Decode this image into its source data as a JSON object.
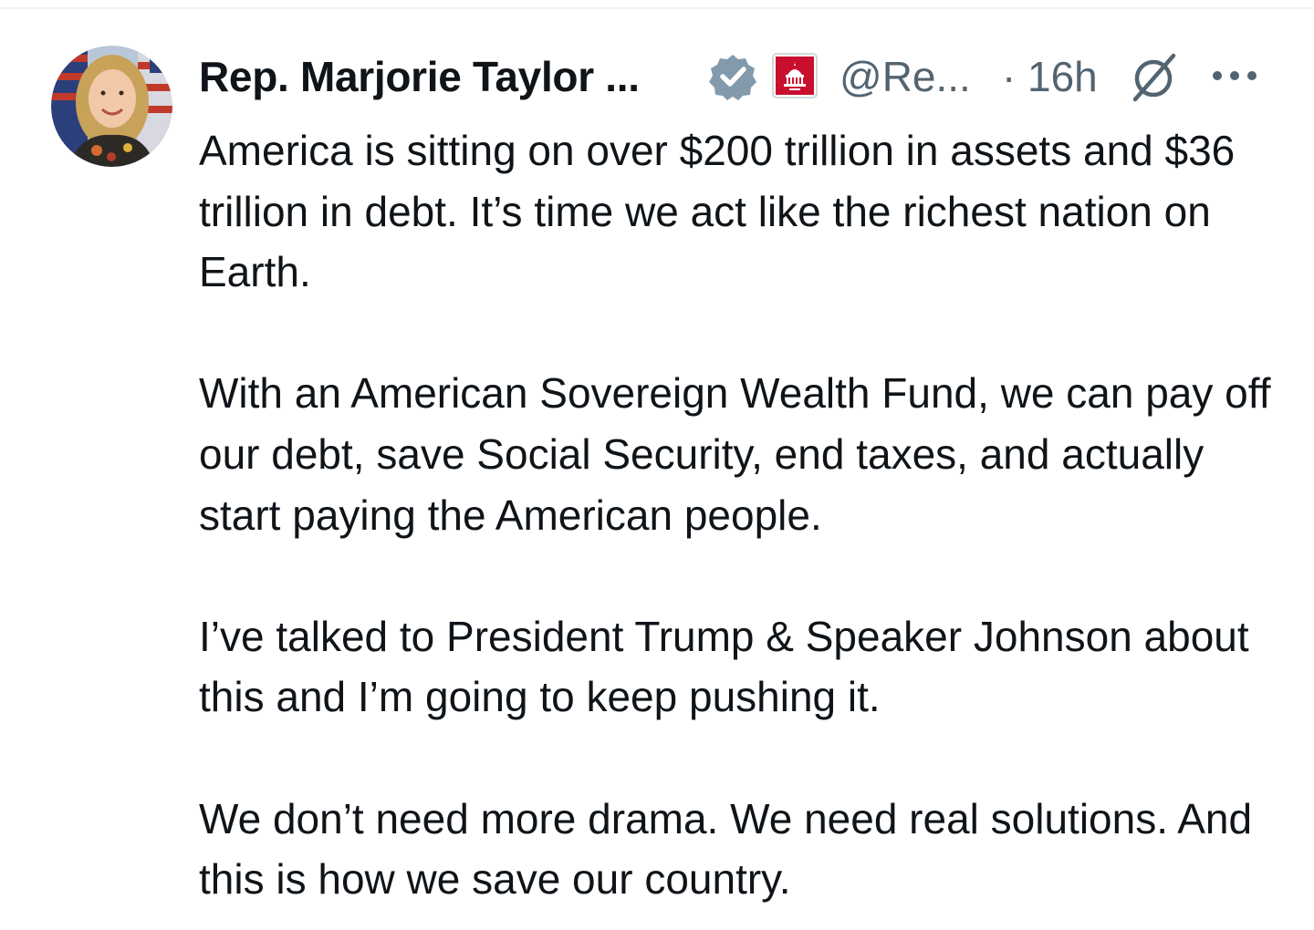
{
  "post": {
    "author": {
      "display_name": "Rep. Marjorie Taylor ...",
      "handle": "@Re...",
      "verified_badge": "verified-badge-icon",
      "affiliation_badge": "capitol-affiliation-icon",
      "avatar": "avatar-photo"
    },
    "separator": "·",
    "timestamp": "16h",
    "actions": {
      "grok_icon": "grok-icon",
      "more_icon": "more-options-icon"
    },
    "paragraphs": [
      "America is sitting on over $200 trillion in assets and $36 trillion in debt. It’s time we act like the richest nation on Earth.",
      "With an American Sovereign Wealth Fund, we can pay off our debt, save Social Security, end taxes, and actually start paying the American people.",
      "I’ve talked to President Trump & Speaker Johnson about this and I’m going to keep pushing it.",
      "We don’t need more drama. We need real solutions. And this is how we save our country."
    ]
  },
  "colors": {
    "text_primary": "#0f1419",
    "text_secondary": "#536471",
    "verified_blue": "#829aab",
    "badge_red": "#c8102e"
  }
}
